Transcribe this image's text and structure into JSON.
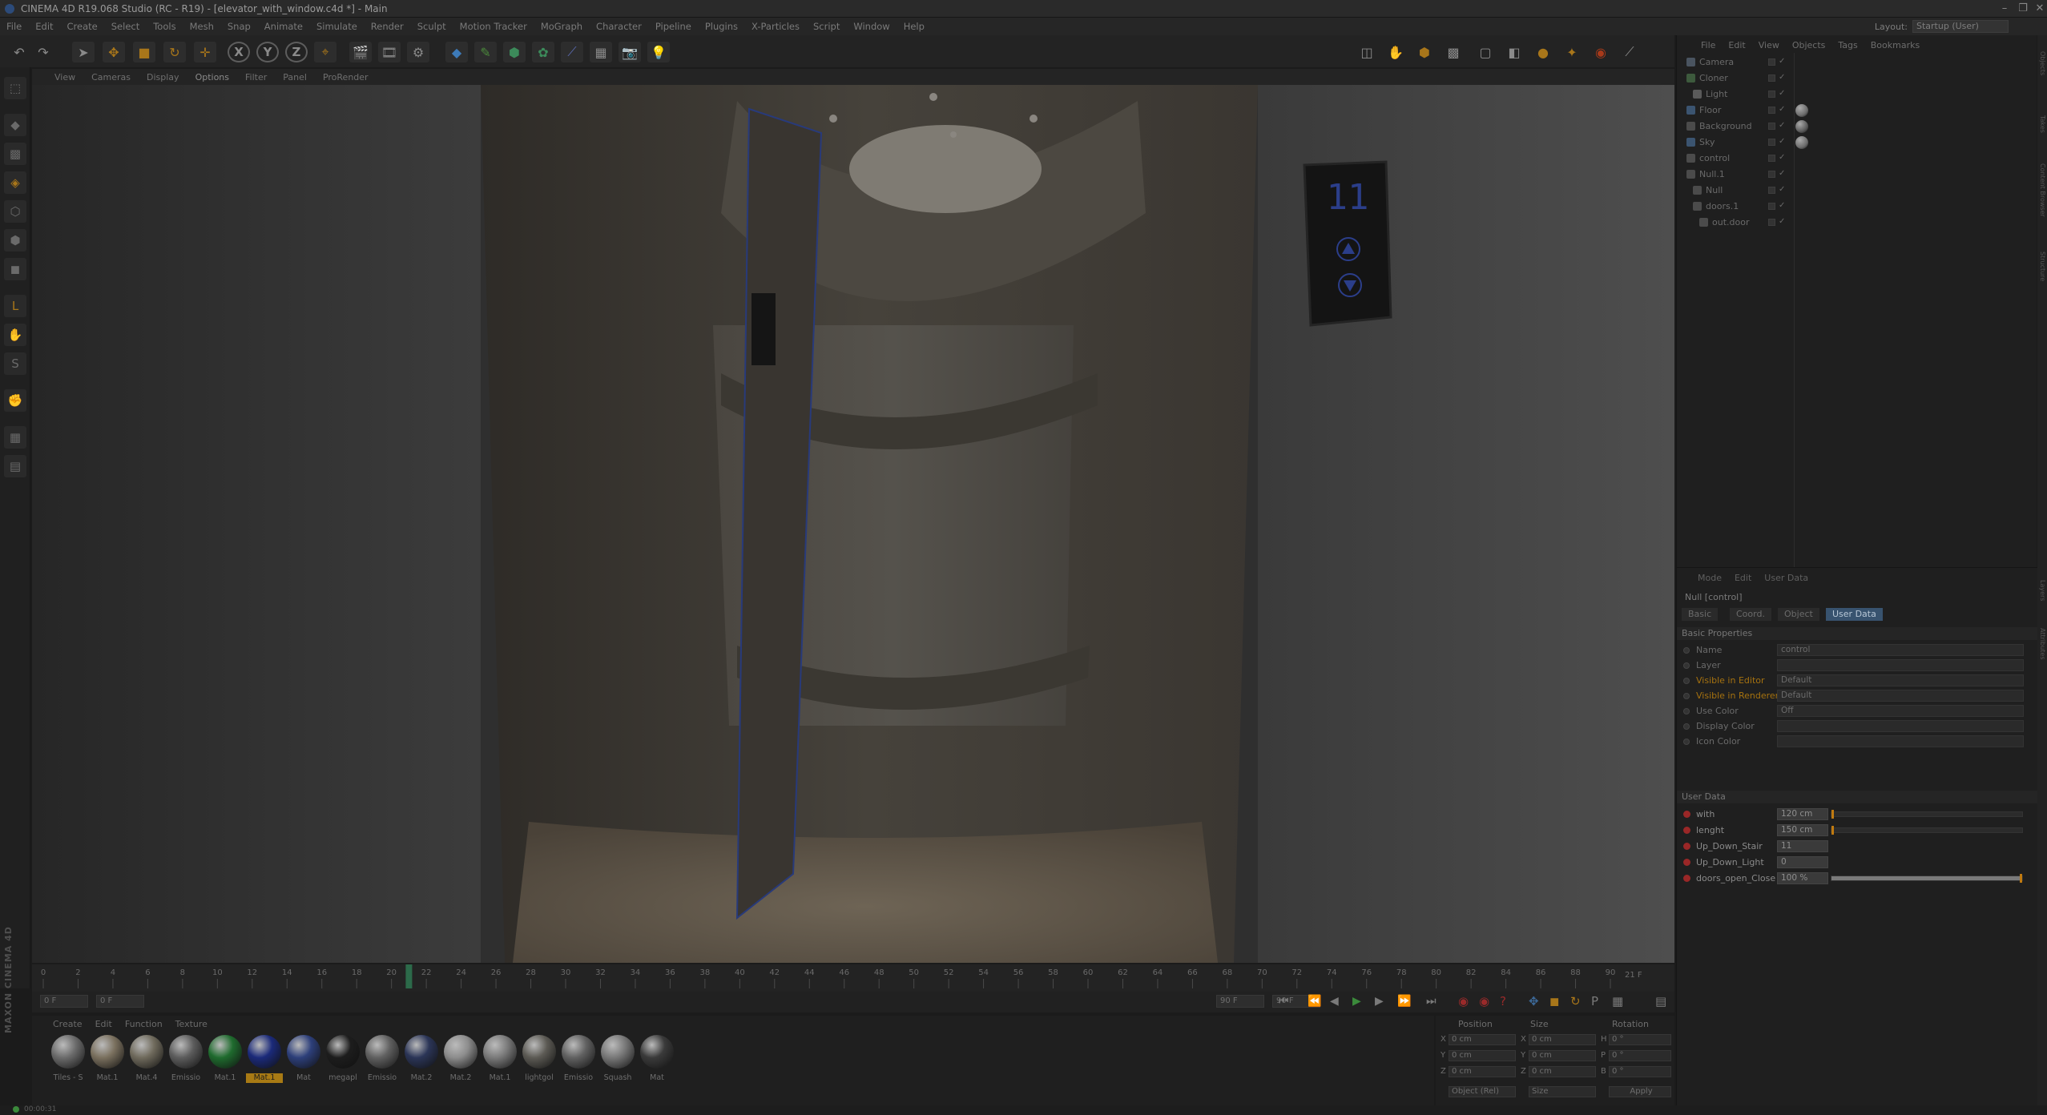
{
  "window": {
    "title": "CINEMA 4D R19.068 Studio (RC - R19) - [elevator_with_window.c4d *] - Main",
    "minimize": "–",
    "maximize": "❐",
    "close": "✕"
  },
  "menubar": {
    "items": [
      "File",
      "Edit",
      "Create",
      "Select",
      "Tools",
      "Mesh",
      "Snap",
      "Animate",
      "Simulate",
      "Render",
      "Sculpt",
      "Motion Tracker",
      "MoGraph",
      "Character",
      "Pipeline",
      "Plugins",
      "X-Particles",
      "Script",
      "Window",
      "Help"
    ],
    "layout_label": "Layout:",
    "layout_value": "Startup (User)"
  },
  "toolbar": {
    "axis_x": "X",
    "axis_y": "Y",
    "axis_z": "Z"
  },
  "viewport_menu": {
    "items": [
      "View",
      "Cameras",
      "Display",
      "Options",
      "Filter",
      "Panel",
      "ProRender"
    ]
  },
  "elevator_display": {
    "floor_number": "11"
  },
  "timeline": {
    "ticks": [
      "0",
      "2",
      "4",
      "6",
      "8",
      "10",
      "12",
      "14",
      "16",
      "18",
      "20",
      "22",
      "24",
      "26",
      "28",
      "30",
      "32",
      "34",
      "36",
      "38",
      "40",
      "42",
      "44",
      "46",
      "48",
      "50",
      "52",
      "54",
      "56",
      "58",
      "60",
      "62",
      "64",
      "66",
      "68",
      "70",
      "72",
      "74",
      "76",
      "78",
      "80",
      "82",
      "84",
      "86",
      "88",
      "90"
    ],
    "current_frame_label": "21 F",
    "current_frame": 21,
    "max_frame": 90,
    "start_field": "0 F",
    "end_field": "90 F",
    "min_field": "0 F",
    "max_field": "90 F"
  },
  "material_panel": {
    "menu": [
      "Create",
      "Edit",
      "Function",
      "Texture"
    ],
    "materials": [
      {
        "label": "Tiles - S",
        "color": "#6b6b6b"
      },
      {
        "label": "Mat.1",
        "color": "#7a705e"
      },
      {
        "label": "Mat.4",
        "color": "#6f6a5c"
      },
      {
        "label": "Emissio",
        "color": "#5c5c5c"
      },
      {
        "label": "Mat.1",
        "color": "#1f6b2e"
      },
      {
        "label": "Mat.1",
        "color": "#1b2a7a"
      },
      {
        "label": "Mat",
        "color": "#2d3f7a"
      },
      {
        "label": "megapl",
        "color": "#1d1d1d"
      },
      {
        "label": "Emissio",
        "color": "#606060"
      },
      {
        "label": "Mat.2",
        "color": "#2b3557"
      },
      {
        "label": "Mat.2",
        "color": "#8c8c8c"
      },
      {
        "label": "Mat.1",
        "color": "#7a7a7a"
      },
      {
        "label": "lightgol",
        "color": "#5c5a54"
      },
      {
        "label": "Emissio",
        "color": "#616161"
      },
      {
        "label": "Squash",
        "color": "#787878"
      },
      {
        "label": "Mat",
        "color": "#3a3a3a"
      }
    ],
    "active_index": 5
  },
  "coordinates": {
    "headers": [
      "Position",
      "Size",
      "Rotation"
    ],
    "rows": [
      {
        "axis": "X",
        "pos": "0 cm",
        "size_axis": "X",
        "size": "0 cm",
        "rot_axis": "H",
        "rot": "0 °"
      },
      {
        "axis": "Y",
        "pos": "0 cm",
        "size_axis": "Y",
        "size": "0 cm",
        "rot_axis": "P",
        "rot": "0 °"
      },
      {
        "axis": "Z",
        "pos": "0 cm",
        "size_axis": "Z",
        "size": "0 cm",
        "rot_axis": "B",
        "rot": "0 °"
      }
    ],
    "mode": "Object (Rel)",
    "size_mode": "Size",
    "apply": "Apply"
  },
  "object_manager": {
    "menu": [
      "File",
      "Edit",
      "View",
      "Objects",
      "Tags",
      "Bookmarks"
    ],
    "objects": [
      {
        "name": "Camera",
        "icon_color": "#4a5460",
        "tag": ""
      },
      {
        "name": "Cloner",
        "icon_color": "#3d5a3d",
        "tag": ""
      },
      {
        "name": "Light",
        "icon_color": "#5a5a5a",
        "tag": ""
      },
      {
        "name": "Floor",
        "icon_color": "#3b5470",
        "tag": "#6c6c6c"
      },
      {
        "name": "Background",
        "icon_color": "#4b4b4b",
        "tag": "#5b5b5b"
      },
      {
        "name": "Sky",
        "icon_color": "#3b5470",
        "tag": "#6c6c6c"
      },
      {
        "name": "control",
        "icon_color": "#4b4b4b",
        "tag": ""
      },
      {
        "name": "Null.1",
        "icon_color": "#4b4b4b",
        "tag": ""
      },
      {
        "name": "Null",
        "icon_color": "#4b4b4b",
        "tag": ""
      },
      {
        "name": "doors.1",
        "icon_color": "#4b4b4b",
        "tag": ""
      },
      {
        "name": "out.door",
        "icon_color": "#4b4b4b",
        "tag": ""
      }
    ]
  },
  "attribute_manager": {
    "menu": [
      "Mode",
      "Edit",
      "User Data"
    ],
    "object_title": "Null [control]",
    "tabs": [
      "Basic",
      "Coord.",
      "Object",
      "User Data"
    ],
    "active_tab": "User Data",
    "basic_section": "Basic Properties",
    "basic": [
      {
        "label": "Name",
        "value": "control",
        "orange": false
      },
      {
        "label": "Layer",
        "value": "",
        "orange": false
      },
      {
        "label": "Visible in Editor",
        "value": "Default",
        "orange": true
      },
      {
        "label": "Visible in Renderer",
        "value": "Default",
        "orange": true
      },
      {
        "label": "Use Color",
        "value": "Off",
        "orange": false
      },
      {
        "label": "Display Color",
        "value": "",
        "orange": false
      },
      {
        "label": "Icon Color",
        "value": "",
        "orange": false
      }
    ],
    "userdata_section": "User Data",
    "userdata": [
      {
        "label": "with",
        "value": "120 cm",
        "level": 0.0
      },
      {
        "label": "lenght",
        "value": "150 cm",
        "level": 0.0
      },
      {
        "label": "Up_Down_Stair",
        "value": "11",
        "level": null
      },
      {
        "label": "Up_Down_Light",
        "value": "0",
        "level": null
      },
      {
        "label": "doors_open_Close",
        "value": "100 %",
        "level": 1.0
      }
    ]
  },
  "statusbar": {
    "brand": "MAXON CINEMA 4D",
    "time": "00:00:31"
  },
  "right_tabs": [
    "Objects",
    "Takes",
    "Content Browser",
    "Structure",
    "Layers",
    "Attributes"
  ]
}
